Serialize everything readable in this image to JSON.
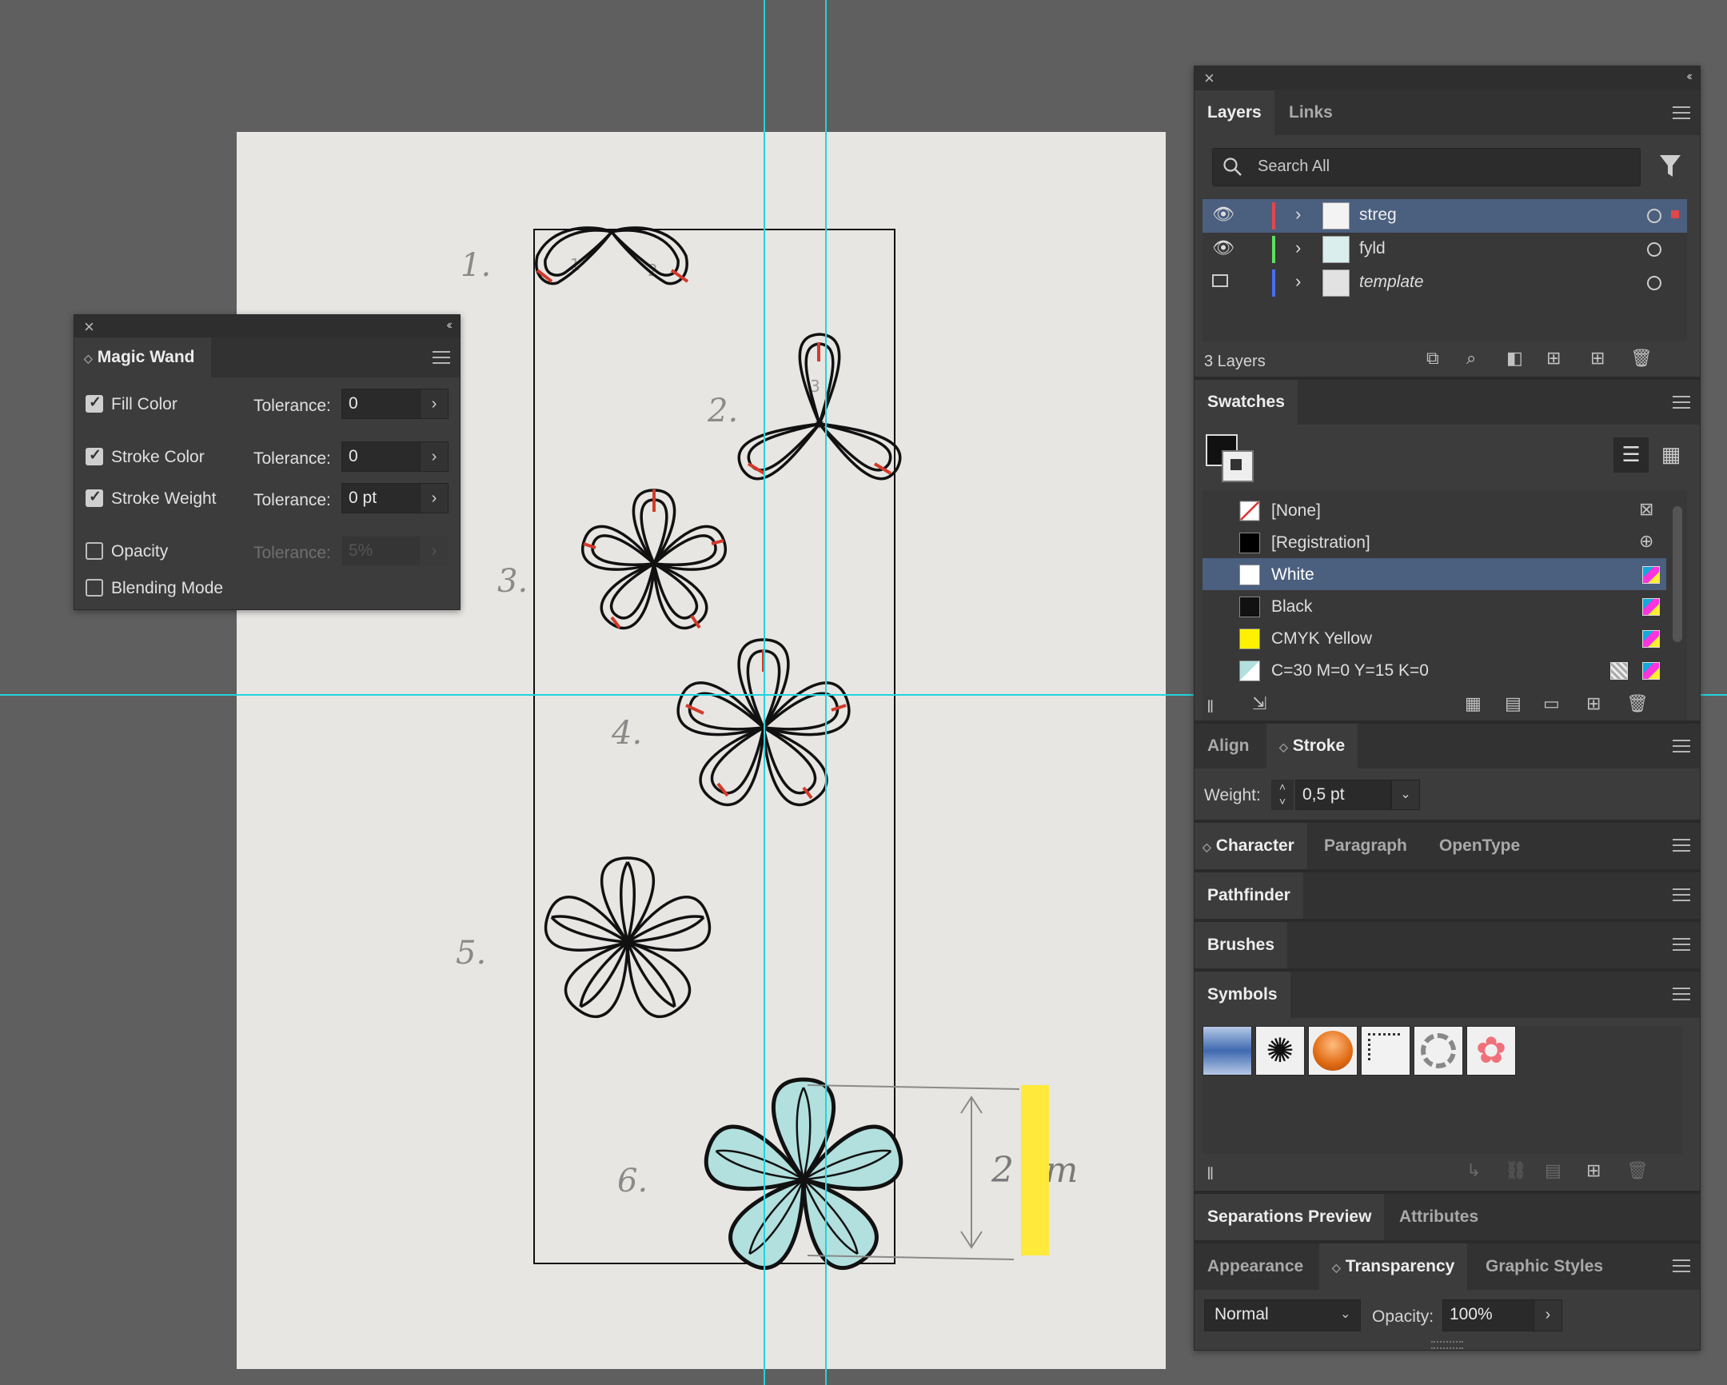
{
  "magic_wand": {
    "title": "Magic Wand",
    "rows": [
      {
        "label": "Fill Color",
        "checked": true,
        "tol_label": "Tolerance:",
        "tol_value": "0"
      },
      {
        "label": "Stroke Color",
        "checked": true,
        "tol_label": "Tolerance:",
        "tol_value": "0"
      },
      {
        "label": "Stroke Weight",
        "checked": true,
        "tol_label": "Tolerance:",
        "tol_value": "0 pt"
      },
      {
        "label": "Opacity",
        "checked": false,
        "tol_label": "Tolerance:",
        "tol_value": "5%"
      },
      {
        "label": "Blending Mode",
        "checked": false
      }
    ]
  },
  "layers_panel": {
    "tabs": [
      "Layers",
      "Links"
    ],
    "search_placeholder": "Search All",
    "layers": [
      {
        "name": "streg",
        "color": "#e0484c",
        "selected": true
      },
      {
        "name": "fyld",
        "color": "#5ee05e",
        "selected": false
      },
      {
        "name": "template",
        "color": "#4a6cf0",
        "selected": false
      }
    ],
    "count": "3 Layers"
  },
  "swatches_panel": {
    "title": "Swatches",
    "swatches": [
      {
        "name": "[None]",
        "color": "none"
      },
      {
        "name": "[Registration]",
        "color": "#000000"
      },
      {
        "name": "White",
        "color": "#ffffff",
        "selected": true
      },
      {
        "name": "Black",
        "color": "#111111"
      },
      {
        "name": "CMYK Yellow",
        "color": "#fff200"
      },
      {
        "name": "C=30 M=0 Y=15 K=0",
        "color": "#b1e0de"
      }
    ]
  },
  "stroke_panel": {
    "tabs": [
      "Align",
      "Stroke"
    ],
    "weight_label": "Weight:",
    "weight_value": "0,5 pt"
  },
  "character_panel": {
    "tabs": [
      "Character",
      "Paragraph",
      "OpenType"
    ]
  },
  "pathfinder_panel": {
    "title": "Pathfinder"
  },
  "brushes_panel": {
    "title": "Brushes"
  },
  "symbols_panel": {
    "title": "Symbols"
  },
  "separations_panel": {
    "tabs": [
      "Separations Preview",
      "Attributes"
    ]
  },
  "transparency_panel": {
    "tabs": [
      "Appearance",
      "Transparency",
      "Graphic Styles"
    ],
    "blend_mode": "Normal",
    "opacity_label": "Opacity:",
    "opacity_value": "100%"
  },
  "artwork": {
    "step_numbers": [
      "1.",
      "2.",
      "3.",
      "4.",
      "5.",
      "6."
    ],
    "petal_numbers": [
      "1",
      "2",
      "3"
    ],
    "dimension_note": "2 cm",
    "highlight_color": "#ffe93a",
    "fill_color": "#b1e0de"
  }
}
